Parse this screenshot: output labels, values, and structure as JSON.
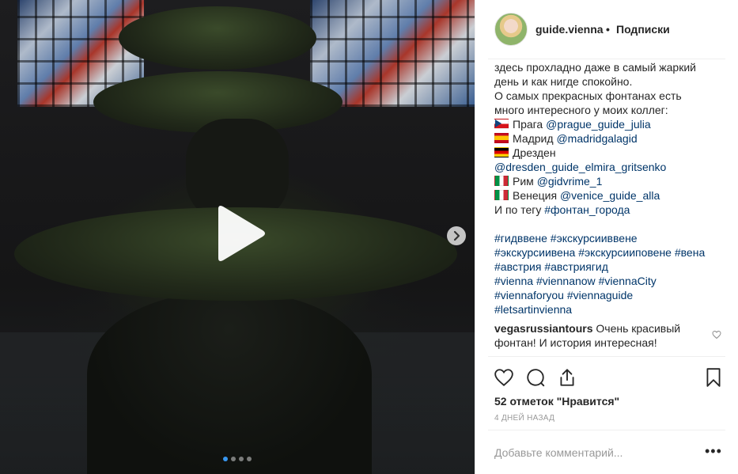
{
  "header": {
    "username": "guide.vienna",
    "separator": "•",
    "follow_label": "Подписки"
  },
  "caption_lines": [
    "здесь прохладно даже в самый жаркий",
    "день и как нигде спокойно.",
    "О самых прекрасных фонтанах есть",
    "много интересного у моих коллег:"
  ],
  "colleagues": [
    {
      "flag": "cz",
      "city": "Прага",
      "handle": "@prague_guide_julia"
    },
    {
      "flag": "es",
      "city": "Мадрид",
      "handle": "@madridgalagid"
    },
    {
      "flag": "de",
      "city": "Дрезден",
      "handle": "@dresden_guide_elmira_gritsenko"
    },
    {
      "flag": "it",
      "city": "Рим",
      "handle": "@gidvrime_1"
    },
    {
      "flag": "it",
      "city": "Венеция",
      "handle": "@venice_guide_alla"
    }
  ],
  "tag_line": {
    "text": "И по тегу",
    "tag": "#фонтан_города"
  },
  "hashtag_lines": [
    [
      "#гидввене",
      "#экскурсииввене"
    ],
    [
      "#экскурсиивена",
      "#экскурсииповене",
      "#вена"
    ],
    [
      "#австрия",
      "#австриягид"
    ],
    [
      "#vienna",
      "#viennanow",
      "#viennaCity"
    ],
    [
      "#viennaforyou",
      "#viennaguide"
    ],
    [
      "#letsartinvienna"
    ]
  ],
  "comment": {
    "author": "vegasrussiantours",
    "text_line1": "Очень красивый",
    "text_line2": "фонтан! И история интересная!"
  },
  "likes_text": "52 отметок \"Нравится\"",
  "timestamp": "4 ДНЕЙ НАЗАД",
  "add_comment_placeholder": "Добавьте комментарий...",
  "more_label": "•••",
  "carousel": {
    "count": 4,
    "active": 1
  },
  "colors": {
    "link": "#003569",
    "muted": "#999999",
    "dot_active": "#3897f0"
  },
  "icons": [
    "play-icon",
    "chevron-right-icon",
    "heart-icon",
    "comment-icon",
    "share-icon",
    "bookmark-icon"
  ]
}
